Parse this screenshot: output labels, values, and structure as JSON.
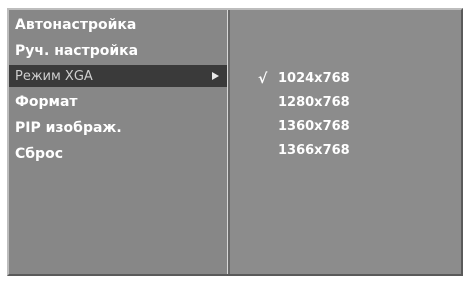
{
  "menu": {
    "items": [
      {
        "label": "Автонастройка"
      },
      {
        "label": "Руч. настройка"
      },
      {
        "label": "Режим XGA",
        "selected": true,
        "has_submenu": true
      },
      {
        "label": "Формат"
      },
      {
        "label": "PIP изображ."
      },
      {
        "label": "Сброс"
      }
    ]
  },
  "submenu": {
    "check_mark": "√",
    "options": [
      {
        "label": "1024x768",
        "checked": true
      },
      {
        "label": "1280x768",
        "checked": false
      },
      {
        "label": "1360x768",
        "checked": false
      },
      {
        "label": "1366x768",
        "checked": false
      }
    ]
  },
  "colors": {
    "panel": "#878787",
    "selected_row": "#3a3a3a",
    "text": "#ffffff"
  },
  "icons": {
    "submenu_arrow": "arrow-right-icon"
  }
}
